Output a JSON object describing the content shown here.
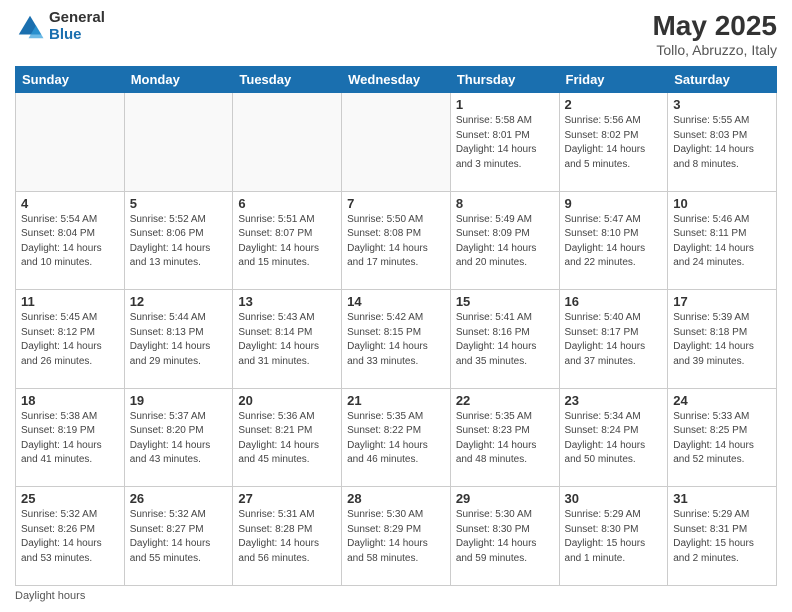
{
  "header": {
    "logo_general": "General",
    "logo_blue": "Blue",
    "title": "May 2025",
    "subtitle": "Tollo, Abruzzo, Italy"
  },
  "days_of_week": [
    "Sunday",
    "Monday",
    "Tuesday",
    "Wednesday",
    "Thursday",
    "Friday",
    "Saturday"
  ],
  "footer": "Daylight hours",
  "weeks": [
    [
      {
        "day": "",
        "info": ""
      },
      {
        "day": "",
        "info": ""
      },
      {
        "day": "",
        "info": ""
      },
      {
        "day": "",
        "info": ""
      },
      {
        "day": "1",
        "info": "Sunrise: 5:58 AM\nSunset: 8:01 PM\nDaylight: 14 hours\nand 3 minutes."
      },
      {
        "day": "2",
        "info": "Sunrise: 5:56 AM\nSunset: 8:02 PM\nDaylight: 14 hours\nand 5 minutes."
      },
      {
        "day": "3",
        "info": "Sunrise: 5:55 AM\nSunset: 8:03 PM\nDaylight: 14 hours\nand 8 minutes."
      }
    ],
    [
      {
        "day": "4",
        "info": "Sunrise: 5:54 AM\nSunset: 8:04 PM\nDaylight: 14 hours\nand 10 minutes."
      },
      {
        "day": "5",
        "info": "Sunrise: 5:52 AM\nSunset: 8:06 PM\nDaylight: 14 hours\nand 13 minutes."
      },
      {
        "day": "6",
        "info": "Sunrise: 5:51 AM\nSunset: 8:07 PM\nDaylight: 14 hours\nand 15 minutes."
      },
      {
        "day": "7",
        "info": "Sunrise: 5:50 AM\nSunset: 8:08 PM\nDaylight: 14 hours\nand 17 minutes."
      },
      {
        "day": "8",
        "info": "Sunrise: 5:49 AM\nSunset: 8:09 PM\nDaylight: 14 hours\nand 20 minutes."
      },
      {
        "day": "9",
        "info": "Sunrise: 5:47 AM\nSunset: 8:10 PM\nDaylight: 14 hours\nand 22 minutes."
      },
      {
        "day": "10",
        "info": "Sunrise: 5:46 AM\nSunset: 8:11 PM\nDaylight: 14 hours\nand 24 minutes."
      }
    ],
    [
      {
        "day": "11",
        "info": "Sunrise: 5:45 AM\nSunset: 8:12 PM\nDaylight: 14 hours\nand 26 minutes."
      },
      {
        "day": "12",
        "info": "Sunrise: 5:44 AM\nSunset: 8:13 PM\nDaylight: 14 hours\nand 29 minutes."
      },
      {
        "day": "13",
        "info": "Sunrise: 5:43 AM\nSunset: 8:14 PM\nDaylight: 14 hours\nand 31 minutes."
      },
      {
        "day": "14",
        "info": "Sunrise: 5:42 AM\nSunset: 8:15 PM\nDaylight: 14 hours\nand 33 minutes."
      },
      {
        "day": "15",
        "info": "Sunrise: 5:41 AM\nSunset: 8:16 PM\nDaylight: 14 hours\nand 35 minutes."
      },
      {
        "day": "16",
        "info": "Sunrise: 5:40 AM\nSunset: 8:17 PM\nDaylight: 14 hours\nand 37 minutes."
      },
      {
        "day": "17",
        "info": "Sunrise: 5:39 AM\nSunset: 8:18 PM\nDaylight: 14 hours\nand 39 minutes."
      }
    ],
    [
      {
        "day": "18",
        "info": "Sunrise: 5:38 AM\nSunset: 8:19 PM\nDaylight: 14 hours\nand 41 minutes."
      },
      {
        "day": "19",
        "info": "Sunrise: 5:37 AM\nSunset: 8:20 PM\nDaylight: 14 hours\nand 43 minutes."
      },
      {
        "day": "20",
        "info": "Sunrise: 5:36 AM\nSunset: 8:21 PM\nDaylight: 14 hours\nand 45 minutes."
      },
      {
        "day": "21",
        "info": "Sunrise: 5:35 AM\nSunset: 8:22 PM\nDaylight: 14 hours\nand 46 minutes."
      },
      {
        "day": "22",
        "info": "Sunrise: 5:35 AM\nSunset: 8:23 PM\nDaylight: 14 hours\nand 48 minutes."
      },
      {
        "day": "23",
        "info": "Sunrise: 5:34 AM\nSunset: 8:24 PM\nDaylight: 14 hours\nand 50 minutes."
      },
      {
        "day": "24",
        "info": "Sunrise: 5:33 AM\nSunset: 8:25 PM\nDaylight: 14 hours\nand 52 minutes."
      }
    ],
    [
      {
        "day": "25",
        "info": "Sunrise: 5:32 AM\nSunset: 8:26 PM\nDaylight: 14 hours\nand 53 minutes."
      },
      {
        "day": "26",
        "info": "Sunrise: 5:32 AM\nSunset: 8:27 PM\nDaylight: 14 hours\nand 55 minutes."
      },
      {
        "day": "27",
        "info": "Sunrise: 5:31 AM\nSunset: 8:28 PM\nDaylight: 14 hours\nand 56 minutes."
      },
      {
        "day": "28",
        "info": "Sunrise: 5:30 AM\nSunset: 8:29 PM\nDaylight: 14 hours\nand 58 minutes."
      },
      {
        "day": "29",
        "info": "Sunrise: 5:30 AM\nSunset: 8:30 PM\nDaylight: 14 hours\nand 59 minutes."
      },
      {
        "day": "30",
        "info": "Sunrise: 5:29 AM\nSunset: 8:30 PM\nDaylight: 15 hours\nand 1 minute."
      },
      {
        "day": "31",
        "info": "Sunrise: 5:29 AM\nSunset: 8:31 PM\nDaylight: 15 hours\nand 2 minutes."
      }
    ]
  ]
}
